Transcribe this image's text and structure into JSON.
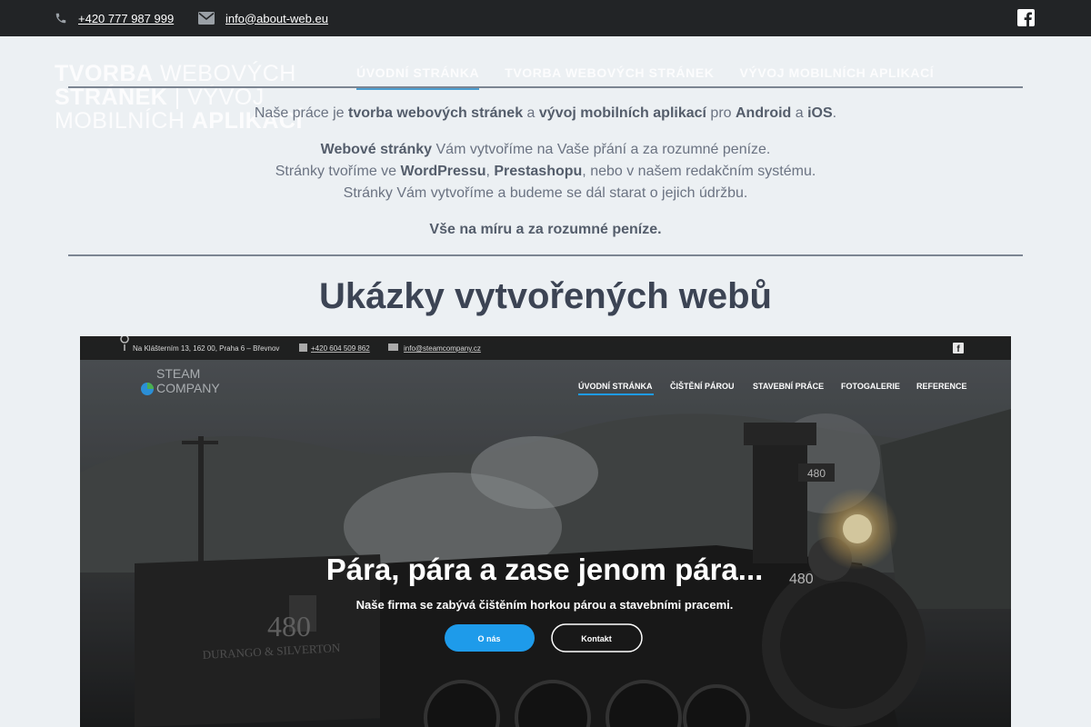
{
  "topbar": {
    "phone": "+420 777 987 999",
    "email": "info@about-web.eu",
    "icons": [
      "phone-icon",
      "envelope-icon",
      "facebook-icon"
    ]
  },
  "logo": {
    "line_bold_1": "TVORBA",
    "line_rest_1": " WEBOVÝCH",
    "line_bold_2": "STRÁNEK",
    "line_rest_2": " | VÝVOJ",
    "line_3a": "MOBILNÍCH ",
    "line_3b": "APLIKACÍ"
  },
  "nav": {
    "items": [
      "ÚVODNÍ STRÁNKA",
      "TVORBA WEBOVÝCH STRÁNEK",
      "VÝVOJ MOBILNÍCH APLIKACÍ"
    ]
  },
  "intro": {
    "p1": [
      "Naše práce je ",
      "tvorba webových stránek",
      " a ",
      "vývoj mobilních aplikací",
      " pro ",
      "Android",
      " a ",
      "iOS",
      "."
    ],
    "p2_line1": [
      "Webové stránky",
      " Vám vytvoříme na Vaše přání a za rozumné peníze."
    ],
    "p2_line2": [
      "Stránky tvoříme ve ",
      "WordPressu",
      ", ",
      "Prestashopu",
      ", nebo v našem redakčním systému."
    ],
    "p2_line3": "Stránky Vám vytvoříme a budeme se dál starat o jejich údržbu.",
    "p3": "Vše na míru a za rozumné peníze."
  },
  "section": {
    "title": "Ukázky vytvořených webů"
  },
  "showcase": {
    "address": "Na Klášterním 13, 162 00, Praha 6 – Břevnov",
    "phone": "+420 604 509 862",
    "email": "info@steamcompany.cz",
    "logo": "STEAM COMPANY",
    "nav": [
      "ÚVODNÍ STRÁNKA",
      "ČIŠTĚNÍ PÁROU",
      "STAVEBNÍ PRÁCE",
      "FOTOGALERIE",
      "REFERENCE"
    ],
    "headline": "Pára, pára a zase jenom pára...",
    "subline": "Naše firma se zabývá čištěním horkou párou a stavebními pracemi.",
    "btn_primary": "O nás",
    "btn_secondary": "Kontakt",
    "loco_number": "480",
    "loco_name": "DURANGO & SILVERTON",
    "accent": "#1e9bea"
  }
}
